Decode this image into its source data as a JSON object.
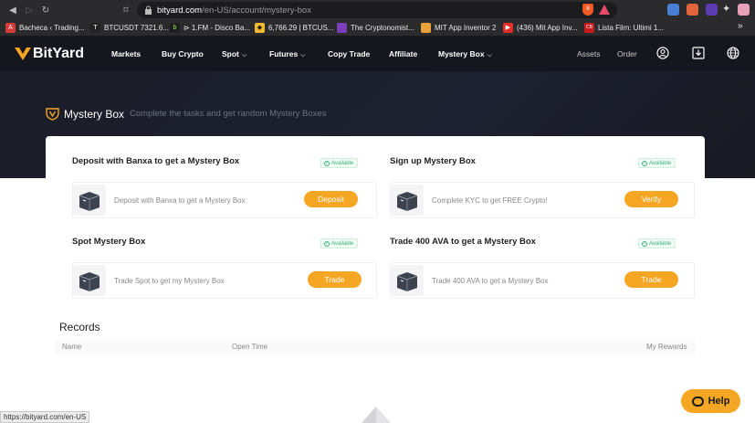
{
  "browser": {
    "url_host": "bityard.com",
    "url_path": "/en-US/account/mystery-box",
    "shield_count": "8",
    "bookmarks": [
      {
        "label": "Bacheca ‹ Trading...",
        "color": "#d83a3a",
        "glyph": "A"
      },
      {
        "label": "BTCUSDT 7321.6...",
        "color": "#222222",
        "glyph": "TV"
      },
      {
        "label": "⊳ 1.FM - Disco Ba...",
        "color": "#1e1e1e",
        "glyph": "b"
      },
      {
        "label": "6,766.29 | BTCUS...",
        "color": "#f3ba2f",
        "glyph": "◆"
      },
      {
        "label": "The Cryptonomist...",
        "color": "#7a3dbb",
        "glyph": ""
      },
      {
        "label": "MIT App Inventor 2",
        "color": "#e8a23a",
        "glyph": "▦"
      },
      {
        "label": "(436) Mit App Inv...",
        "color": "#e52d27",
        "glyph": "▶"
      },
      {
        "label": "Lista Film: Ultimi 1...",
        "color": "#c91c1c",
        "glyph": "CB"
      }
    ],
    "more_bookmarks": "»",
    "status_url": "https://bityard.com/en-US"
  },
  "header": {
    "logo_text": "BitYard",
    "nav": [
      {
        "label": "Markets",
        "dropdown": false
      },
      {
        "label": "Buy Crypto",
        "dropdown": false
      },
      {
        "label": "Spot",
        "dropdown": true
      },
      {
        "label": "Futures",
        "dropdown": true
      },
      {
        "label": "Copy Trade",
        "dropdown": false
      },
      {
        "label": "Affiliate",
        "dropdown": false
      },
      {
        "label": "Mystery Box",
        "dropdown": true
      }
    ],
    "assets": "Assets",
    "order": "Order"
  },
  "hero": {
    "title": "Mystery Box",
    "subtitle": "Complete the tasks and get random Mystery Boxes"
  },
  "tasks": [
    {
      "title": "Deposit with Banxa to get a Mystery Box",
      "status": "Available",
      "desc": "Deposit with Banxa to get a Mystery Box",
      "action": "Deposit"
    },
    {
      "title": "Sign up Mystery Box",
      "status": "Available",
      "desc": "Complete KYC to get FREE Crypto!",
      "action": "Verify"
    },
    {
      "title": "Spot Mystery Box",
      "status": "Available",
      "desc": "Trade Spot to get my Mystery Box",
      "action": "Trade"
    },
    {
      "title": "Trade 400 AVA to get a Mystery Box",
      "status": "Available",
      "desc": "Trade 400 AVA to get a Mystery Box",
      "action": "Trade"
    }
  ],
  "records": {
    "title": "Records",
    "columns": [
      "Name",
      "Open Time",
      "My Rewards"
    ]
  },
  "help": {
    "label": "Help"
  },
  "colors": {
    "accent": "#f5a623",
    "header_bg": "#15171e",
    "available_green": "#3db17b"
  }
}
